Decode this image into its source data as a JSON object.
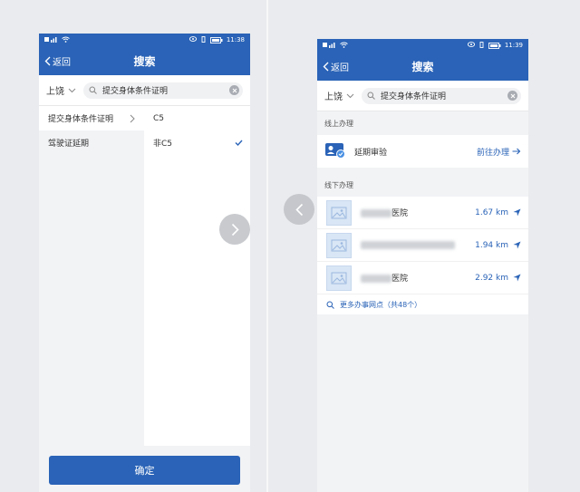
{
  "colors": {
    "primary": "#2a63b7",
    "background": "#f2f3f5"
  },
  "left_screen": {
    "status": {
      "time": "11:38",
      "battery": "78"
    },
    "nav": {
      "back_label": "返回",
      "title": "搜索"
    },
    "search": {
      "city": "上饶",
      "query": "提交身体条件证明"
    },
    "categories": [
      {
        "label": "提交身体条件证明"
      },
      {
        "label": "驾驶证延期"
      }
    ],
    "options": [
      {
        "label": "C5"
      },
      {
        "label": "非C5"
      }
    ],
    "confirm_label": "确定"
  },
  "right_screen": {
    "status": {
      "time": "11:39",
      "battery": "78"
    },
    "nav": {
      "back_label": "返回",
      "title": "搜索"
    },
    "search": {
      "city": "上饶",
      "query": "提交身体条件证明"
    },
    "online": {
      "section_label": "线上办理",
      "item_label": "延期审验",
      "action_label": "前往办理",
      "icon": "id-card-check-icon"
    },
    "offline": {
      "section_label": "线下办理",
      "offices": [
        {
          "name": "医院",
          "distance": "1.67 km"
        },
        {
          "name": "",
          "distance": "1.94 km"
        },
        {
          "name": "医院",
          "distance": "2.92 km"
        }
      ],
      "more_label": "更多办事网点（共48个）"
    }
  }
}
